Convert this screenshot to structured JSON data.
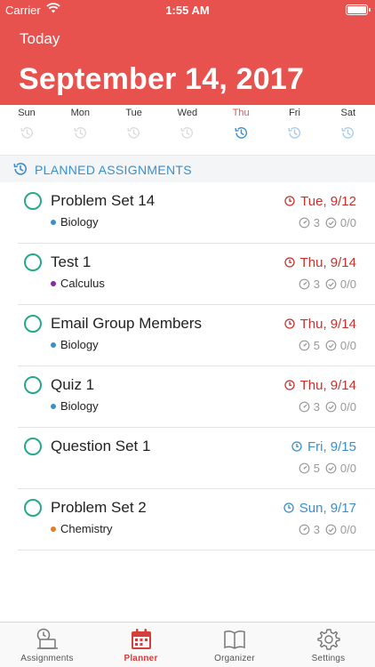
{
  "status_bar": {
    "carrier": "Carrier",
    "time": "1:55 AM"
  },
  "header": {
    "today_label": "Today",
    "date": "September 14, 2017"
  },
  "colors": {
    "header_red": "#e8524e",
    "overdue_red": "#c9302c",
    "future_blue": "#3a8fcb",
    "check_green": "#26a88a"
  },
  "week": [
    {
      "label": "Sun",
      "active": false
    },
    {
      "label": "Mon",
      "active": false
    },
    {
      "label": "Tue",
      "active": false
    },
    {
      "label": "Wed",
      "active": false
    },
    {
      "label": "Thu",
      "active": true
    },
    {
      "label": "Fri",
      "active": false
    },
    {
      "label": "Sat",
      "active": false
    }
  ],
  "section": {
    "title": "PLANNED ASSIGNMENTS",
    "icon": "history-icon"
  },
  "assignments": [
    {
      "title": "Problem Set 14",
      "subject": "Biology",
      "subject_color": "#3a8fcb",
      "due": "Tue, 9/12",
      "due_color": "#c9302c",
      "effort": "3",
      "progress": "0/0"
    },
    {
      "title": "Test 1",
      "subject": "Calculus",
      "subject_color": "#8e24aa",
      "due": "Thu, 9/14",
      "due_color": "#c9302c",
      "effort": "3",
      "progress": "0/0"
    },
    {
      "title": "Email Group Members",
      "subject": "Biology",
      "subject_color": "#3a8fcb",
      "due": "Thu, 9/14",
      "due_color": "#c9302c",
      "effort": "5",
      "progress": "0/0"
    },
    {
      "title": "Quiz 1",
      "subject": "Biology",
      "subject_color": "#3a8fcb",
      "due": "Thu, 9/14",
      "due_color": "#c9302c",
      "effort": "3",
      "progress": "0/0"
    },
    {
      "title": "Question Set 1",
      "subject": "",
      "subject_color": "",
      "due": "Fri, 9/15",
      "due_color": "#3a8fcb",
      "effort": "5",
      "progress": "0/0"
    },
    {
      "title": "Problem Set 2",
      "subject": "Chemistry",
      "subject_color": "#e67e22",
      "due": "Sun, 9/17",
      "due_color": "#3a8fcb",
      "effort": "3",
      "progress": "0/0"
    }
  ],
  "tabs": [
    {
      "label": "Assignments",
      "icon": "assignments-icon",
      "active": false
    },
    {
      "label": "Planner",
      "icon": "calendar-icon",
      "active": true
    },
    {
      "label": "Organizer",
      "icon": "book-icon",
      "active": false
    },
    {
      "label": "Settings",
      "icon": "gear-icon",
      "active": false
    }
  ]
}
